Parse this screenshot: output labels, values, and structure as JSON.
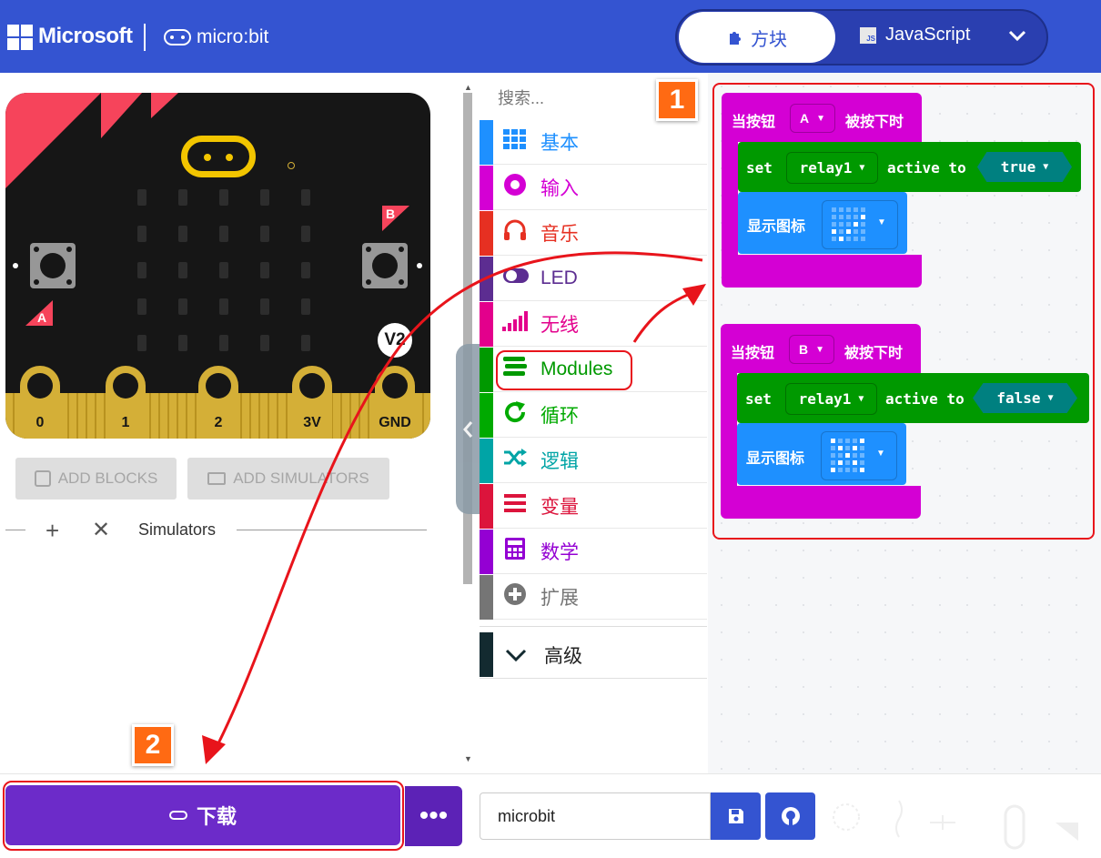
{
  "header": {
    "brand_microsoft": "Microsoft",
    "brand_microbit": "micro:bit",
    "tab_blocks": "方块",
    "tab_js": "JavaScript",
    "js_badge": "JS"
  },
  "simulator": {
    "pins": [
      "0",
      "1",
      "2",
      "3V",
      "GND"
    ],
    "button_a_label": "A",
    "button_b_label": "B",
    "version_badge": "V2",
    "add_blocks": "ADD BLOCKS",
    "add_simulators": "ADD SIMULATORS",
    "sim_tab": "Simulators"
  },
  "toolbox": {
    "search_placeholder": "搜索...",
    "categories": [
      {
        "label": "基本",
        "color": "#1e90ff"
      },
      {
        "label": "输入",
        "color": "#d400d4"
      },
      {
        "label": "音乐",
        "color": "#e63022"
      },
      {
        "label": "LED",
        "color": "#5c2d91"
      },
      {
        "label": "无线",
        "color": "#e3008c"
      },
      {
        "label": "Modules",
        "color": "#009900"
      },
      {
        "label": "循环",
        "color": "#00aa00"
      },
      {
        "label": "逻辑",
        "color": "#00a4a6"
      },
      {
        "label": "变量",
        "color": "#dc143c"
      },
      {
        "label": "数学",
        "color": "#9400d3"
      },
      {
        "label": "扩展",
        "color": "#757575"
      }
    ],
    "advanced": "高级"
  },
  "workspace": {
    "blocks": [
      {
        "hat": "当按钮",
        "button": "A",
        "hat_suffix": "被按下时",
        "set": "set",
        "target": "relay1",
        "action": "active to",
        "value": "true",
        "show_icon": "显示图标"
      },
      {
        "hat": "当按钮",
        "button": "B",
        "hat_suffix": "被按下时",
        "set": "set",
        "target": "relay1",
        "action": "active to",
        "value": "false",
        "show_icon": "显示图标"
      }
    ]
  },
  "callouts": {
    "badge1": "1",
    "badge2": "2"
  },
  "footer": {
    "download": "下载",
    "more": "•••",
    "project_name": "microbit"
  }
}
